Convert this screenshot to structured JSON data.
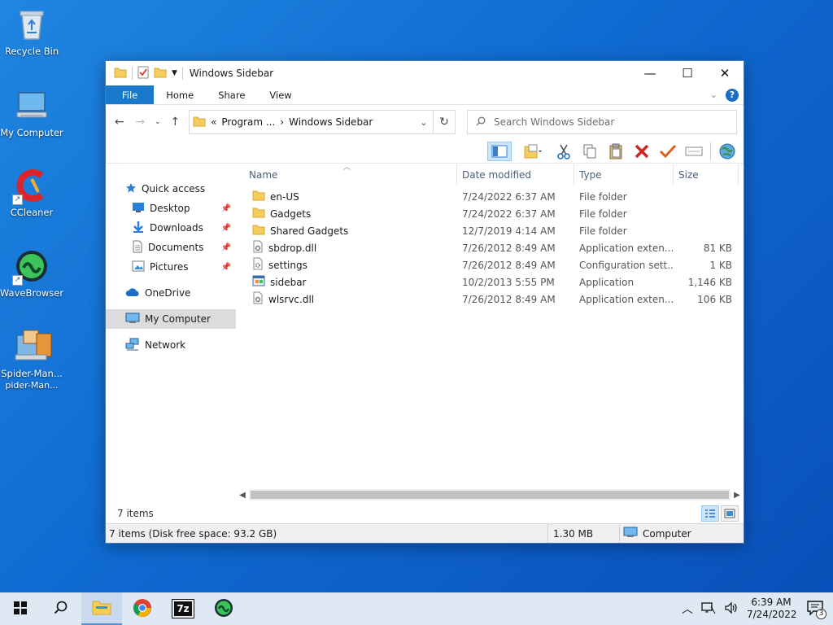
{
  "desktop": {
    "icons": [
      {
        "label": "Recycle Bin",
        "icon": "recycle-bin-icon"
      },
      {
        "label": "My Computer",
        "icon": "computer-icon"
      },
      {
        "label": "CCleaner",
        "icon": "ccleaner-icon"
      },
      {
        "label": "WaveBrowser",
        "icon": "wavebrowser-icon"
      },
      {
        "label": "Spider-Man...",
        "sub": "pider-Man...",
        "icon": "spider-man-icon"
      }
    ]
  },
  "window": {
    "title": "Windows Sidebar",
    "controls": {
      "minimize": "—",
      "maximize": "☐",
      "close": "✕"
    },
    "ribbon_tabs": [
      "File",
      "Home",
      "Share",
      "View"
    ],
    "address": {
      "prefix": "«",
      "segments": [
        "Program ...",
        "Windows Sidebar"
      ],
      "separator": "›"
    },
    "search_placeholder": "Search Windows Sidebar"
  },
  "navigation": {
    "items": [
      {
        "label": "Quick access",
        "icon": "star-icon",
        "child": false
      },
      {
        "label": "Desktop",
        "icon": "desktop-icon",
        "child": true,
        "pinned": true
      },
      {
        "label": "Downloads",
        "icon": "download-icon",
        "child": true,
        "pinned": true
      },
      {
        "label": "Documents",
        "icon": "document-icon",
        "child": true,
        "pinned": true
      },
      {
        "label": "Pictures",
        "icon": "pictures-icon",
        "child": true,
        "pinned": true
      },
      {
        "label": "OneDrive",
        "icon": "cloud-icon",
        "child": false
      },
      {
        "label": "My Computer",
        "icon": "computer-icon",
        "child": false,
        "selected": true
      },
      {
        "label": "Network",
        "icon": "network-icon",
        "child": false
      }
    ]
  },
  "columns": [
    "Name",
    "Date modified",
    "Type",
    "Size"
  ],
  "files": [
    {
      "name": "en-US",
      "date": "7/24/2022 6:37 AM",
      "type": "File folder",
      "size": "",
      "icon": "folder-icon"
    },
    {
      "name": "Gadgets",
      "date": "7/24/2022 6:37 AM",
      "type": "File folder",
      "size": "",
      "icon": "folder-icon"
    },
    {
      "name": "Shared Gadgets",
      "date": "12/7/2019 4:14 AM",
      "type": "File folder",
      "size": "",
      "icon": "folder-icon"
    },
    {
      "name": "sbdrop.dll",
      "date": "7/26/2012 8:49 AM",
      "type": "Application exten...",
      "size": "81 KB",
      "icon": "dll-icon"
    },
    {
      "name": "settings",
      "date": "7/26/2012 8:49 AM",
      "type": "Configuration sett...",
      "size": "1 KB",
      "icon": "settings-file-icon"
    },
    {
      "name": "sidebar",
      "date": "10/2/2013 5:55 PM",
      "type": "Application",
      "size": "1,146 KB",
      "icon": "application-icon"
    },
    {
      "name": "wlsrvc.dll",
      "date": "7/26/2012 8:49 AM",
      "type": "Application exten...",
      "size": "106 KB",
      "icon": "dll-icon"
    }
  ],
  "items_count": "7 items",
  "statusbar": {
    "info": "7 items (Disk free space: 93.2 GB)",
    "size": "1.30 MB",
    "location": "Computer"
  },
  "taskbar": {
    "time": "6:39 AM",
    "date": "7/24/2022",
    "notification_count": "3",
    "apps": [
      "start-icon",
      "search-icon",
      "file-explorer-icon",
      "chrome-icon",
      "7zip-icon",
      "wavebrowser-icon"
    ],
    "sevenzip_label": "7z"
  }
}
